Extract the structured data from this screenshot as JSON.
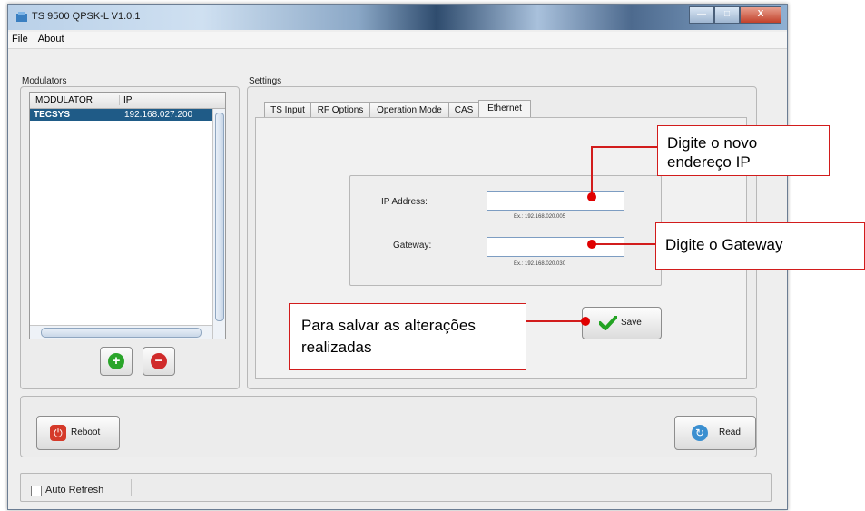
{
  "window": {
    "title": "TS 9500 QPSK-L V1.0.1",
    "buttons": {
      "minimize": "—",
      "maximize": "□",
      "close": "X"
    }
  },
  "menu": {
    "items": [
      "File",
      "About"
    ]
  },
  "modulators": {
    "title": "Modulators",
    "columns": [
      "MODULATOR",
      "IP"
    ],
    "rows": [
      {
        "name": "TECSYS",
        "ip": "192.168.027.200"
      }
    ],
    "selected_row_color": "#1f5b87"
  },
  "settings": {
    "title": "Settings",
    "tabs": [
      "TS Input",
      "RF Options",
      "Operation Mode",
      "CAS",
      "Ethernet"
    ],
    "active_tab": "Ethernet",
    "ip_label": "IP Address:",
    "ip_value": "",
    "ip_hint": "Ex.: 192.168.020.005",
    "gateway_label": "Gateway:",
    "gateway_value": "",
    "gateway_hint": "Ex.: 192.168.020.030",
    "save_label": "Save"
  },
  "actions": {
    "reboot_label": "Reboot",
    "read_label": "Read"
  },
  "status": {
    "auto_refresh_label": "Auto Refresh",
    "auto_refresh_checked": false
  },
  "callouts": {
    "ip": "Digite o novo endereço IP",
    "gateway": "Digite o Gateway",
    "save": "Para salvar as alterações realizadas"
  },
  "colors": {
    "annotation": "#d21c1c",
    "add_icon": "#2aa52a",
    "remove_icon": "#d02b2b"
  },
  "icons": {
    "add": "plus-circle-icon",
    "remove": "minus-circle-icon",
    "save": "checkmark-icon",
    "reboot": "power-icon",
    "read": "refresh-icon"
  }
}
